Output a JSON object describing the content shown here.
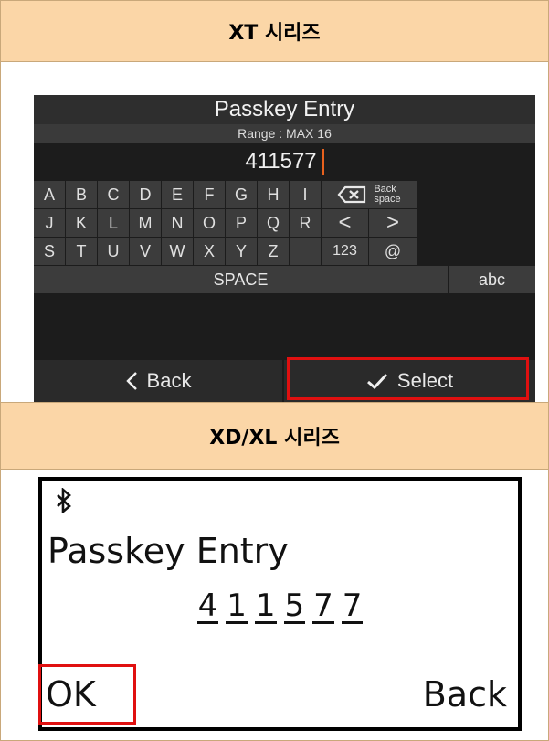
{
  "headers": {
    "xt": "XT 시리즈",
    "xdxl": "XD/XL 시리즈"
  },
  "xt_screen": {
    "title": "Passkey Entry",
    "range": "Range : MAX 16",
    "input_value": "411577",
    "keyboard": {
      "row1": [
        "A",
        "B",
        "C",
        "D",
        "E",
        "F",
        "G",
        "H",
        "I"
      ],
      "row2": [
        "J",
        "K",
        "L",
        "M",
        "N",
        "O",
        "P",
        "Q",
        "R"
      ],
      "row3": [
        "S",
        "T",
        "U",
        "V",
        "W",
        "X",
        "Y",
        "Z"
      ],
      "backspace_label_line1": "Back",
      "backspace_label_line2": "space",
      "left_arrow": "<",
      "right_arrow": ">",
      "num_key": "123",
      "at_key": "@",
      "space_key": "SPACE",
      "abc_key": "abc"
    },
    "back_label": "Back",
    "select_label": "Select",
    "highlight_color": "#e01010"
  },
  "lcd_screen": {
    "bluetooth_icon": "bluetooth-icon",
    "title": "Passkey Entry",
    "digits": [
      "4",
      "1",
      "1",
      "5",
      "7",
      "7"
    ],
    "ok_label": "OK",
    "back_label": "Back"
  }
}
